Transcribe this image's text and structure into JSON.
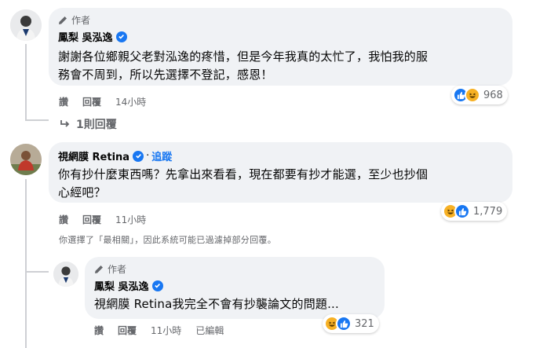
{
  "comments": [
    {
      "author_tag": "作者",
      "name": "鳳梨 吳泓逸",
      "text_line1": "謝謝各位鄉親父老對泓逸的疼惜，但是今年我真的太忙了，我怕我的服",
      "text_line2": "務會不周到，所以先選擇不登記，感恩！",
      "actions": {
        "like": "讚",
        "reply": "回覆",
        "time": "14小時"
      },
      "reaction_count": "968",
      "reply_link": "1則回覆"
    },
    {
      "name": "視網膜 Retina",
      "follow_label": "追蹤",
      "text_line1": "你有抄什麼東西嗎？先拿出來看看，現在都要有抄才能選，至少也抄個",
      "text_line2": "心經吧？",
      "actions": {
        "like": "讚",
        "reply": "回覆",
        "time": "11小時"
      },
      "reaction_count": "1,779",
      "filter_note": "你選擇了「最相關」，因此系統可能已過濾掉部分回覆。"
    },
    {
      "author_tag": "作者",
      "name": "鳳梨 吳泓逸",
      "text_line1": "視網膜 Retina我完全不會有抄襲論文的問題...",
      "actions": {
        "like": "讚",
        "reply": "回覆",
        "time": "11小時",
        "edited": "已編輯"
      },
      "reaction_count": "321"
    }
  ],
  "colors": {
    "accent": "#1877f2",
    "bubble": "#f0f2f5",
    "muted": "#65676b",
    "haha": "#f7b125"
  },
  "icons": [
    "pen-icon",
    "verified-badge-icon",
    "like-reaction-icon",
    "haha-reaction-icon",
    "reply-arrow-icon"
  ]
}
